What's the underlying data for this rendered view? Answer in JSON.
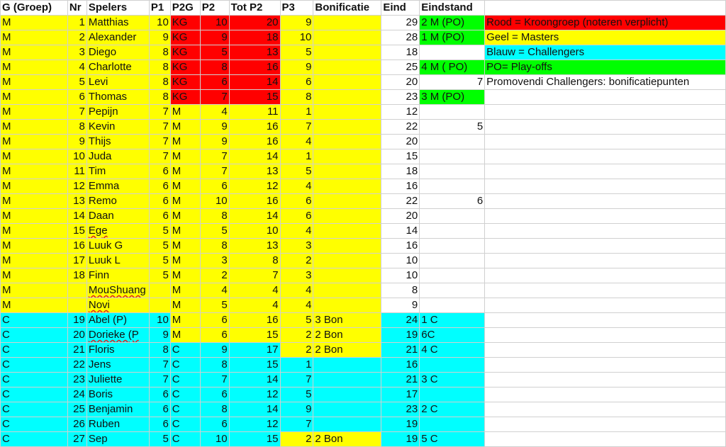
{
  "headers": [
    "G (Groep)",
    "Nr",
    "Spelers",
    "P1",
    "P2G",
    "P2",
    "Tot P2",
    "P3",
    "Bonificatie",
    "Eind",
    "Eindstand",
    ""
  ],
  "colors": {
    "masters": "#ffff00",
    "kroongroep": "#ff0000",
    "challengers": "#00ffff",
    "playoffs": "#00ff00"
  },
  "rows": [
    {
      "g": "M",
      "nr": "1",
      "speler": "Matthias",
      "p1": "10",
      "p2g": "KG",
      "p2": "10",
      "tot": "20",
      "p3": "9",
      "bon": "",
      "eind": "29",
      "eindstand": "2 M (PO)",
      "legend": "Rood = Kroongroep (noteren verplicht)"
    },
    {
      "g": "M",
      "nr": "2",
      "speler": "Alexander",
      "p1": "9",
      "p2g": "KG",
      "p2": "9",
      "tot": "18",
      "p3": "10",
      "bon": "",
      "eind": "28",
      "eindstand": "1 M (PO)",
      "legend": "Geel = Masters"
    },
    {
      "g": "M",
      "nr": "3",
      "speler": "Diego",
      "p1": "8",
      "p2g": "KG",
      "p2": "5",
      "tot": "13",
      "p3": "5",
      "bon": "",
      "eind": "18",
      "eindstand": "",
      "legend": "Blauw = Challengers"
    },
    {
      "g": "M",
      "nr": "4",
      "speler": "Charlotte",
      "p1": "8",
      "p2g": "KG",
      "p2": "8",
      "tot": "16",
      "p3": "9",
      "bon": "",
      "eind": "25",
      "eindstand": "4 M ( PO)",
      "legend": "PO= Play-offs"
    },
    {
      "g": "M",
      "nr": "5",
      "speler": "Levi",
      "p1": "8",
      "p2g": "KG",
      "p2": "6",
      "tot": "14",
      "p3": "6",
      "bon": "",
      "eind": "20",
      "eindstand": "7",
      "legend": "Promovendi Challengers: bonificatiepunten"
    },
    {
      "g": "M",
      "nr": "6",
      "speler": "Thomas",
      "p1": "8",
      "p2g": "KG",
      "p2": "7",
      "tot": "15",
      "p3": "8",
      "bon": "",
      "eind": "23",
      "eindstand": "3 M (PO)",
      "legend": ""
    },
    {
      "g": "M",
      "nr": "7",
      "speler": "Pepijn",
      "p1": "7",
      "p2g": "M",
      "p2": "4",
      "tot": "11",
      "p3": "1",
      "bon": "",
      "eind": "12",
      "eindstand": "",
      "legend": ""
    },
    {
      "g": "M",
      "nr": "8",
      "speler": "Kevin",
      "p1": "7",
      "p2g": "M",
      "p2": "9",
      "tot": "16",
      "p3": "7",
      "bon": "",
      "eind": "22",
      "eindstand": "5",
      "legend": ""
    },
    {
      "g": "M",
      "nr": "9",
      "speler": "Thijs",
      "p1": "7",
      "p2g": "M",
      "p2": "9",
      "tot": "16",
      "p3": "4",
      "bon": "",
      "eind": "20",
      "eindstand": "",
      "legend": ""
    },
    {
      "g": "M",
      "nr": "10",
      "speler": "Juda",
      "p1": "7",
      "p2g": "M",
      "p2": "7",
      "tot": "14",
      "p3": "1",
      "bon": "",
      "eind": "15",
      "eindstand": "",
      "legend": ""
    },
    {
      "g": "M",
      "nr": "11",
      "speler": "Tim",
      "p1": "6",
      "p2g": "M",
      "p2": "7",
      "tot": "13",
      "p3": "5",
      "bon": "",
      "eind": "18",
      "eindstand": "",
      "legend": ""
    },
    {
      "g": "M",
      "nr": "12",
      "speler": "Emma",
      "p1": "6",
      "p2g": "M",
      "p2": "6",
      "tot": "12",
      "p3": "4",
      "bon": "",
      "eind": "16",
      "eindstand": "",
      "legend": ""
    },
    {
      "g": "M",
      "nr": "13",
      "speler": "Remo",
      "p1": "6",
      "p2g": "M",
      "p2": "10",
      "tot": "16",
      "p3": "6",
      "bon": "",
      "eind": "22",
      "eindstand": "6",
      "legend": ""
    },
    {
      "g": "M",
      "nr": "14",
      "speler": "Daan",
      "p1": "6",
      "p2g": "M",
      "p2": "8",
      "tot": "14",
      "p3": "6",
      "bon": "",
      "eind": "20",
      "eindstand": "",
      "legend": ""
    },
    {
      "g": "M",
      "nr": "15",
      "speler": "Ege",
      "p1": "5",
      "p2g": "M",
      "p2": "5",
      "tot": "10",
      "p3": "4",
      "bon": "",
      "eind": "14",
      "eindstand": "",
      "legend": ""
    },
    {
      "g": "M",
      "nr": "16",
      "speler": "Luuk G",
      "p1": "5",
      "p2g": "M",
      "p2": "8",
      "tot": "13",
      "p3": "3",
      "bon": "",
      "eind": "16",
      "eindstand": "",
      "legend": ""
    },
    {
      "g": "M",
      "nr": "17",
      "speler": "Luuk L",
      "p1": "5",
      "p2g": "M",
      "p2": "3",
      "tot": "8",
      "p3": "2",
      "bon": "",
      "eind": "10",
      "eindstand": "",
      "legend": ""
    },
    {
      "g": "M",
      "nr": "18",
      "speler": "Finn",
      "p1": "5",
      "p2g": "M",
      "p2": "2",
      "tot": "7",
      "p3": "3",
      "bon": "",
      "eind": "10",
      "eindstand": "",
      "legend": ""
    },
    {
      "g": "M",
      "nr": "",
      "speler": "MouShuang",
      "p1": "",
      "p2g": "M",
      "p2": "4",
      "tot": "4",
      "p3": "4",
      "bon": "",
      "eind": "8",
      "eindstand": "",
      "legend": ""
    },
    {
      "g": "M",
      "nr": "",
      "speler": "Novi",
      "p1": "",
      "p2g": "M",
      "p2": "5",
      "tot": "4",
      "p3": "4",
      "bon": "",
      "eind": "9",
      "eindstand": "",
      "legend": ""
    },
    {
      "g": "C",
      "nr": "19",
      "speler": "Abel (P)",
      "p1": "10",
      "p2g": "M",
      "p2": "6",
      "tot": "16",
      "p3": "5",
      "bon": "3 Bon",
      "eind": "24",
      "eindstand": "1 C",
      "legend": ""
    },
    {
      "g": "C",
      "nr": "20",
      "speler": "Dorieke (P",
      "p1": "9",
      "p2g": "M",
      "p2": "6",
      "tot": "15",
      "p3": "2",
      "bon": "2 Bon",
      "eind": "19",
      "eindstand": "6C",
      "legend": ""
    },
    {
      "g": "C",
      "nr": "21",
      "speler": "Floris",
      "p1": "8",
      "p2g": "C",
      "p2": "9",
      "tot": "17",
      "p3": "2",
      "bon": "2 Bon",
      "eind": "21",
      "eindstand": "4 C",
      "legend": ""
    },
    {
      "g": "C",
      "nr": "22",
      "speler": "Jens",
      "p1": "7",
      "p2g": "C",
      "p2": "8",
      "tot": "15",
      "p3": "1",
      "bon": "",
      "eind": "16",
      "eindstand": "",
      "legend": ""
    },
    {
      "g": "C",
      "nr": "23",
      "speler": "Juliette",
      "p1": "7",
      "p2g": "C",
      "p2": "7",
      "tot": "14",
      "p3": "7",
      "bon": "",
      "eind": "21",
      "eindstand": "3 C",
      "legend": ""
    },
    {
      "g": "C",
      "nr": "24",
      "speler": "Boris",
      "p1": "6",
      "p2g": "C",
      "p2": "6",
      "tot": "12",
      "p3": "5",
      "bon": "",
      "eind": "17",
      "eindstand": "",
      "legend": ""
    },
    {
      "g": "C",
      "nr": "25",
      "speler": "Benjamin",
      "p1": "6",
      "p2g": "C",
      "p2": "8",
      "tot": "14",
      "p3": "9",
      "bon": "",
      "eind": "23",
      "eindstand": "2 C",
      "legend": ""
    },
    {
      "g": "C",
      "nr": "26",
      "speler": "Ruben",
      "p1": "6",
      "p2g": "C",
      "p2": "6",
      "tot": "12",
      "p3": "7",
      "bon": "",
      "eind": "19",
      "eindstand": "",
      "legend": ""
    },
    {
      "g": "C",
      "nr": "27",
      "speler": "Sep",
      "p1": "5",
      "p2g": "C",
      "p2": "10",
      "tot": "15",
      "p3": "2",
      "bon": "2 Bon",
      "eind": "19",
      "eindstand": "5 C",
      "legend": ""
    }
  ]
}
